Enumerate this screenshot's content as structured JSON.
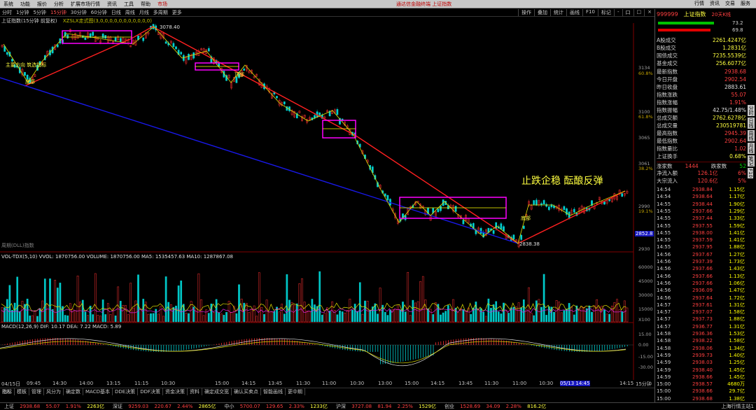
{
  "menu": {
    "items": [
      "系统",
      "功能",
      "报价",
      "分析",
      "扩展市场行情",
      "资讯",
      "工具",
      "帮助",
      "市场"
    ],
    "title": "通达信金融终端 上证指数",
    "right": [
      "行情",
      "资讯",
      "交易",
      "服务"
    ]
  },
  "toolbar": {
    "periods": [
      "分时",
      "1分钟",
      "5分钟",
      "15分钟",
      "30分钟",
      "60分钟",
      "日线",
      "周线",
      "月线",
      "多周期",
      "更多"
    ],
    "active_index": 3,
    "right": [
      "操作",
      "叠加",
      "统计",
      "画线",
      "F10",
      "标记",
      "-",
      "口",
      "□",
      "×"
    ]
  },
  "chart_info": {
    "name": "上证指数(15分钟 前复权)",
    "indicator": "XZSLX走式图(3,0,0,0,0,0,0,0,0,0,0,0)"
  },
  "annotations": {
    "high_label": "3078.40",
    "low_label": "2838.38",
    "slogan": "止跌企稳  酝酿反弹",
    "small1": "主要方向 筑选指标",
    "small2": "底部",
    "small3": "顶部",
    "small4": "底部",
    "price_tag": "2852.8",
    "watermark": "周期(DLL)指数"
  },
  "y_axis_main": [
    "3134",
    "60.8%",
    "3100",
    "61.8%",
    "3065",
    "3061",
    "38.2%",
    "2990",
    "19.1%",
    "2930"
  ],
  "volume_panel": {
    "header": "VOL-TDX(5,10)  VVOL: 1870756.00  VOLUME: 1870756.00  MA5: 1535457.63  MA10: 1287867.08",
    "axis": [
      "60000",
      "45000",
      "30000",
      "15000",
      "X100"
    ]
  },
  "macd_panel": {
    "header": "MACD(12,26,9)  DIF: 10.17  DEA: 7.22  MACD: 5.89",
    "axis": [
      "15.00",
      "0.00",
      "-15.00",
      "-30.00"
    ]
  },
  "time_axis": [
    "04/15日",
    "09:45",
    "14:30",
    "14:00",
    "13:15",
    "11:15",
    "10:30",
    "15:00",
    "14:15",
    "13:45",
    "11:30",
    "11:00",
    "10:30",
    "13:00",
    "15:00",
    "14:15",
    "13:45",
    "11:30",
    "11:00",
    "10:30",
    "05/13 14:45",
    "14:15",
    "15分钟"
  ],
  "bottom_tabs": [
    "指标",
    "模板",
    "管理",
    "风分为",
    "确定数",
    "MACD基本",
    "DDE决策",
    "DDF决策",
    "资金决策",
    "资料",
    "确定成交宽",
    "确认买卖点",
    "智能画线",
    "更中期"
  ],
  "right_panel": {
    "code": "999999",
    "name": "上证指数",
    "tag": "20天K线",
    "bar_top": "73.2",
    "bar_bottom": "69.8",
    "stats": [
      {
        "label": "A股成交",
        "value": "2261.4247亿"
      },
      {
        "label": "B股成交",
        "value": "1.2831亿"
      },
      {
        "label": "国债成交",
        "value": "7235.5539亿"
      },
      {
        "label": "基金成交",
        "value": "256.6077亿"
      },
      {
        "label": "最新指数",
        "value": "2938.68"
      },
      {
        "label": "今日开盘",
        "value": "2902.54"
      },
      {
        "label": "昨日收盘",
        "value": "2883.61"
      },
      {
        "label": "指数涨跌",
        "value": "55.07"
      },
      {
        "label": "指数涨幅",
        "value": "1.91%"
      },
      {
        "label": "指数振幅",
        "value": "42.75/1.48%"
      },
      {
        "label": "总成交额",
        "value": "2762.6278亿"
      },
      {
        "label": "总成交量",
        "value": "230519781"
      },
      {
        "label": "最高指数",
        "value": "2945.39"
      },
      {
        "label": "最低指数",
        "value": "2902.64"
      },
      {
        "label": "指数量比",
        "value": "1.02"
      },
      {
        "label": "上证换手",
        "value": "0.68%"
      }
    ],
    "up_label": "涨家数",
    "up_count": "1444",
    "down_label": "跌家数",
    "down_count": "52",
    "flow": [
      {
        "label": "净流入额",
        "value": "126.1亿",
        "pct": "6%"
      },
      {
        "label": "大宗流入",
        "value": "120.6亿",
        "pct": "5%"
      }
    ],
    "ticks": [
      {
        "t": "14:54",
        "p": "2938.84",
        "v": "1.15亿"
      },
      {
        "t": "14:54",
        "p": "2938.64",
        "v": "1.17亿"
      },
      {
        "t": "14:55",
        "p": "2938.44",
        "v": "1.90亿"
      },
      {
        "t": "14:55",
        "p": "2937.66",
        "v": "1.29亿"
      },
      {
        "t": "14:55",
        "p": "2937.44",
        "v": "1.33亿"
      },
      {
        "t": "14:55",
        "p": "2937.55",
        "v": "1.59亿"
      },
      {
        "t": "14:55",
        "p": "2938.00",
        "v": "1.41亿"
      },
      {
        "t": "14:55",
        "p": "2937.59",
        "v": "1.41亿"
      },
      {
        "t": "14:55",
        "p": "2937.95",
        "v": "1.88亿"
      },
      {
        "t": "14:56",
        "p": "2937.67",
        "v": "1.27亿"
      },
      {
        "t": "14:56",
        "p": "2937.39",
        "v": "1.73亿"
      },
      {
        "t": "14:56",
        "p": "2937.66",
        "v": "1.43亿"
      },
      {
        "t": "14:56",
        "p": "2937.66",
        "v": "1.13亿"
      },
      {
        "t": "14:56",
        "p": "2937.66",
        "v": "1.06亿"
      },
      {
        "t": "14:56",
        "p": "2936.09",
        "v": "1.47亿"
      },
      {
        "t": "14:56",
        "p": "2937.64",
        "v": "1.72亿"
      },
      {
        "t": "14:57",
        "p": "2937.61",
        "v": "1.31亿"
      },
      {
        "t": "14:57",
        "p": "2937.07",
        "v": "1.58亿"
      },
      {
        "t": "14:57",
        "p": "2937.73",
        "v": "1.88亿"
      },
      {
        "t": "14:57",
        "p": "2936.77",
        "v": "1.31亿"
      },
      {
        "t": "14:58",
        "p": "2936.36",
        "v": "1.53亿"
      },
      {
        "t": "14:58",
        "p": "2938.22",
        "v": "1.58亿"
      },
      {
        "t": "14:58",
        "p": "2938.06",
        "v": "1.34亿"
      },
      {
        "t": "14:59",
        "p": "2939.73",
        "v": "1.40亿"
      },
      {
        "t": "14:59",
        "p": "2938.03",
        "v": "1.25亿"
      },
      {
        "t": "14:59",
        "p": "2938.40",
        "v": "1.45亿"
      },
      {
        "t": "14:59",
        "p": "2938.66",
        "v": "1.45亿"
      },
      {
        "t": "15:00",
        "p": "2938.57",
        "v": "4680万"
      },
      {
        "t": "15:00",
        "p": "2938.66",
        "v": "29.7亿"
      },
      {
        "t": "15:00",
        "p": "2938.68",
        "v": "1.38亿"
      }
    ]
  },
  "side_tabs": [
    "分时",
    "日线",
    "周线",
    "月线",
    "笔记",
    "F10"
  ],
  "status_bar": [
    {
      "label": "上证",
      "v": "2938.68",
      "c": "55.07",
      "p": "1.91%",
      "a": "2263亿"
    },
    {
      "label": "深证",
      "v": "9259.03",
      "c": "220.67",
      "p": "2.44%",
      "a": "2865亿"
    },
    {
      "label": "中小",
      "v": "5700.07",
      "c": "129.65",
      "p": "2.33%",
      "a": "1233亿"
    },
    {
      "label": "沪深",
      "v": "3727.08",
      "c": "81.94",
      "p": "2.25%",
      "a": "1529亿"
    },
    {
      "label": "创业",
      "v": "1528.69",
      "c": "34.09",
      "p": "2.28%",
      "a": "816.2亿"
    }
  ],
  "status_right": "上海行情主站1",
  "colors": {
    "up": "#ff3030",
    "down": "#00d0d0",
    "accent": "#c8c8c8",
    "magenta": "#ff00ff",
    "blue": "#1010e0",
    "yellow": "#ffff40"
  }
}
